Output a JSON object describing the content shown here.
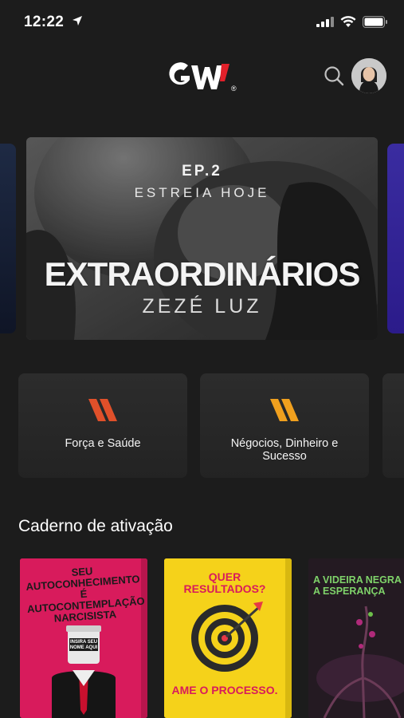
{
  "status_bar": {
    "time": "12:22"
  },
  "header": {
    "logo_text": "GW",
    "logo_mark": "®",
    "search_icon": "search-icon",
    "avatar_icon": "user-avatar"
  },
  "banner": {
    "episode": "EP.2",
    "subtitle": "ESTREIA HOJE",
    "title": "EXTRAORDINÁRIOS",
    "author": "ZEZÉ LUZ"
  },
  "categories": [
    {
      "label": "Força e Saúde",
      "accent": "#e0502a"
    },
    {
      "label": "Négocios, Dinheiro e Sucesso",
      "accent": "#f0a01e"
    }
  ],
  "section": {
    "title": "Caderno de ativação"
  },
  "books": [
    {
      "cover_text": "SEU AUTOCONHECIMENTO É AUTOCONTEMPLAÇÃO NARCISISTA",
      "jar_label": "INSIRA SEU NOME AQUI",
      "bg": "#d81b5c"
    },
    {
      "cover_text_top": "QUER RESULTADOS?",
      "cover_text_bottom": "AME O PROCESSO.",
      "bg": "#f5d21a"
    },
    {
      "cover_text": "A VIDEIRA NEGRA E A ESPERANÇA",
      "bg": "#241a22"
    }
  ],
  "colors": {
    "background": "#1c1c1c",
    "card": "#2a2a2a",
    "logo_red": "#e2202a"
  }
}
